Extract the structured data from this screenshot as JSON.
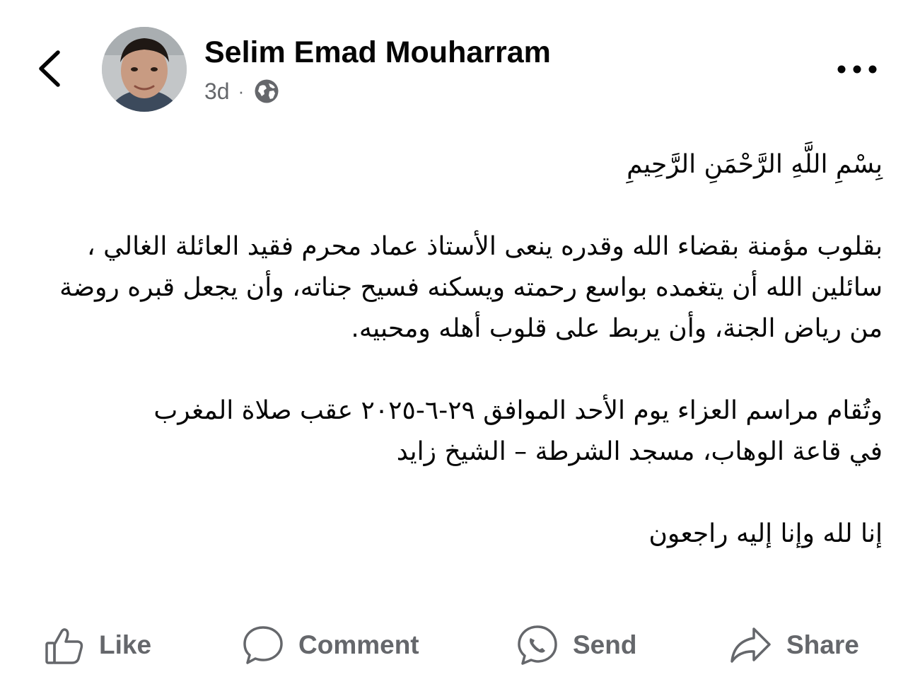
{
  "header": {
    "back_icon": "chevron-left-icon",
    "author_name": "Selim Emad Mouharram",
    "timestamp": "3d",
    "separator": "·",
    "privacy_icon": "globe-icon",
    "more_icon": "ellipsis-icon"
  },
  "post": {
    "basmala": "بِسْمِ اللَّهِ الرَّحْمَنِ الرَّحِيمِ",
    "paragraph1": "بقلوب مؤمنة بقضاء الله وقدره ينعى الأستاذ عماد محرم  فقيد العائلة الغالي ،\nسائلين الله أن يتغمده بواسع رحمته ويسكنه فسيح جناته، وأن يجعل قبره روضة من رياض الجنة، وأن يربط على قلوب أهله ومحبيه.",
    "paragraph2": "وتُقام مراسم العزاء يوم الأحد الموافق ٢٩-٦-٢٠٢٥ عقب صلاة المغرب\nفي قاعة الوهاب، مسجد الشرطة – الشيخ زايد",
    "closing": "إنا لله وإنا إليه راجعون"
  },
  "actions": [
    {
      "label": "Like",
      "icon": "thumbs-up-icon"
    },
    {
      "label": "Comment",
      "icon": "comment-bubble-icon"
    },
    {
      "label": "Send",
      "icon": "messenger-icon"
    },
    {
      "label": "Share",
      "icon": "share-arrow-icon"
    }
  ],
  "colors": {
    "text_primary": "#050505",
    "text_secondary": "#65676b",
    "background": "#ffffff"
  }
}
